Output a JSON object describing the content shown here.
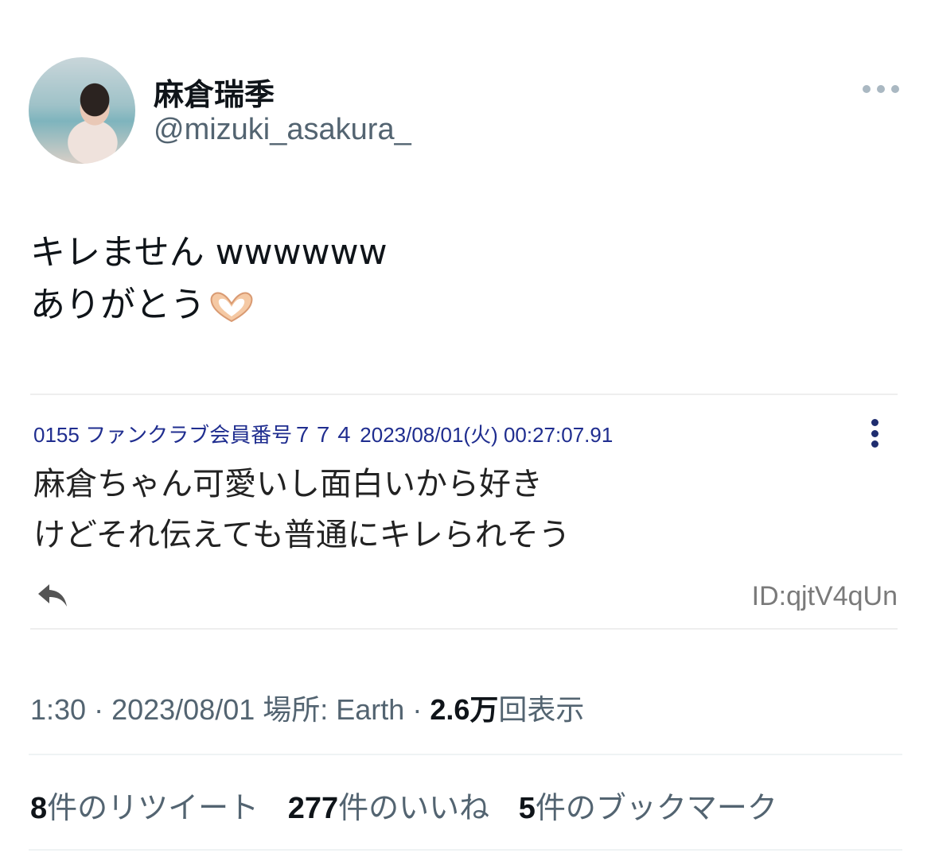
{
  "author": {
    "display_name": "麻倉瑞季",
    "handle": "@mizuki_asakura_"
  },
  "tweet": {
    "text_line1": "キレません wwwwww",
    "text_line2": "ありがとう",
    "emoji": "heart-hands-emoji"
  },
  "quoted_post": {
    "header": "0155 ファンクラブ会員番号７７４ 2023/08/01(火) 00:27:07.91",
    "body_line1": "麻倉ちゃん可愛いし面白いから好き",
    "body_line2": "けどそれ伝えても普通にキレられそう",
    "id": "ID:qjtV4qUn"
  },
  "meta": {
    "time": "1:30",
    "sep1": " · ",
    "date": "2023/08/01",
    "location_label": " 場所: Earth",
    "sep2": " · ",
    "views_value": "2.6万",
    "views_label": "回表示"
  },
  "stats": {
    "retweets_count": "8",
    "retweets_label": "件のリツイート",
    "likes_count": "277",
    "likes_label": "件のいいね",
    "bookmarks_count": "5",
    "bookmarks_label": "件のブックマーク"
  },
  "colors": {
    "primary_text": "#0f1419",
    "secondary_text": "#536471",
    "quote_header": "#1f2d8f",
    "divider": "#eff3f4"
  }
}
